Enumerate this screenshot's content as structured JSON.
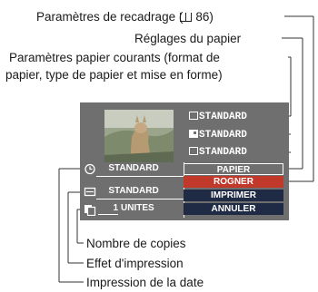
{
  "callouts": {
    "recadrage": "Paramètres de recadrage (​",
    "recadrage_ref": "86)",
    "reglages": "Réglages du papier",
    "courants_line1": "Paramètres papier courants (format de",
    "courants_line2": "papier, type de papier et mise en forme)",
    "copies": "Nombre de copies",
    "effet": "Effet d'impression",
    "date": "Impression de la date"
  },
  "panel": {
    "paper_size": "STANDARD",
    "paper_type": "STANDARD",
    "layout": "STANDARD",
    "date_value": "STANDARD",
    "effect_value": "STANDARD",
    "copies_value": "1",
    "copies_unit": "UNITES",
    "menu": [
      "PAPIER",
      "ROGNER",
      "IMPRIMER",
      "ANNULER"
    ]
  },
  "colors": {
    "panel_bg": "#6f6f6f",
    "menu_highlight": "#c0392b",
    "menu_dark": "#1f2a44",
    "lines": "#333333"
  }
}
